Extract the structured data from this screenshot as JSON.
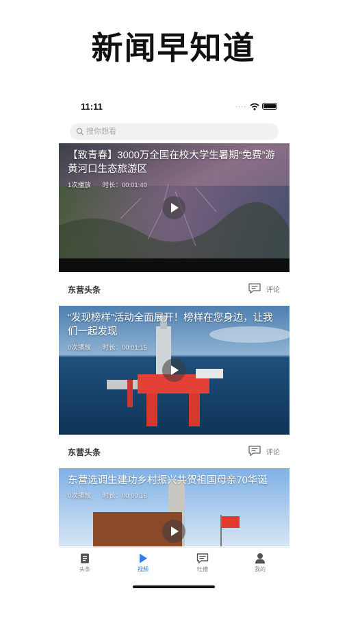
{
  "promo": {
    "title": "新闻早知道"
  },
  "status_bar": {
    "time": "11:11",
    "signal": "····"
  },
  "search": {
    "placeholder": "搜你想看"
  },
  "feed": {
    "items": [
      {
        "title": "【致青春】3000万全国在校大学生暑期“免费”游黄河口生态旅游区",
        "plays": "1次播放",
        "duration": "时长：00:01:40",
        "source": "东营头条",
        "comment_label": "评论"
      },
      {
        "title": "“发现榜样”活动全面展开！榜样在您身边，让我们一起发现",
        "plays": "0次播放",
        "duration": "时长：00:01:15",
        "source": "东营头条",
        "comment_label": "评论"
      },
      {
        "title": "东营选调生建功乡村振兴共贺祖国母亲70华诞",
        "plays": "0次播放",
        "duration": "时长：00:00:16"
      }
    ]
  },
  "tabs": [
    {
      "label": "头条",
      "icon": "news-icon",
      "active": false
    },
    {
      "label": "视频",
      "icon": "play-icon",
      "active": true
    },
    {
      "label": "吐槽",
      "icon": "comment-icon",
      "active": false
    },
    {
      "label": "我的",
      "icon": "user-icon",
      "active": false
    }
  ],
  "colors": {
    "accent": "#2f80ed"
  }
}
